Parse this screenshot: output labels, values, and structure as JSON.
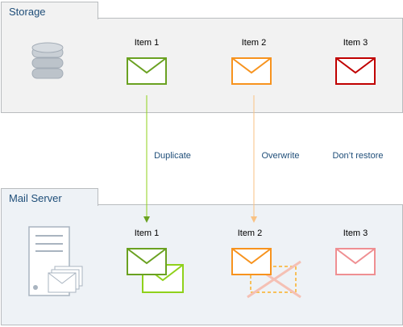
{
  "storage": {
    "title": "Storage",
    "items": [
      "Item 1",
      "Item 2",
      "Item 3"
    ]
  },
  "mail_server": {
    "title": "Mail Server",
    "items": [
      "Item 1",
      "Item 2",
      "Item 3"
    ]
  },
  "actions": {
    "duplicate": "Duplicate",
    "overwrite": "Overwrite",
    "dont_restore": "Don’t restore"
  },
  "colors": {
    "panel_fill": "#f2f2f2",
    "panel_border": "#b9bcbf",
    "title_text": "#1f4e79",
    "action_text": "#1f4e79",
    "green": "#6aa121",
    "green_light": "#8fd11b",
    "orange": "#f7931e",
    "orange_light": "#f9c283",
    "red": "#c00000",
    "red_light": "#ef8f92",
    "cross": "#f5c0b4",
    "device": "#a9b4c0"
  }
}
